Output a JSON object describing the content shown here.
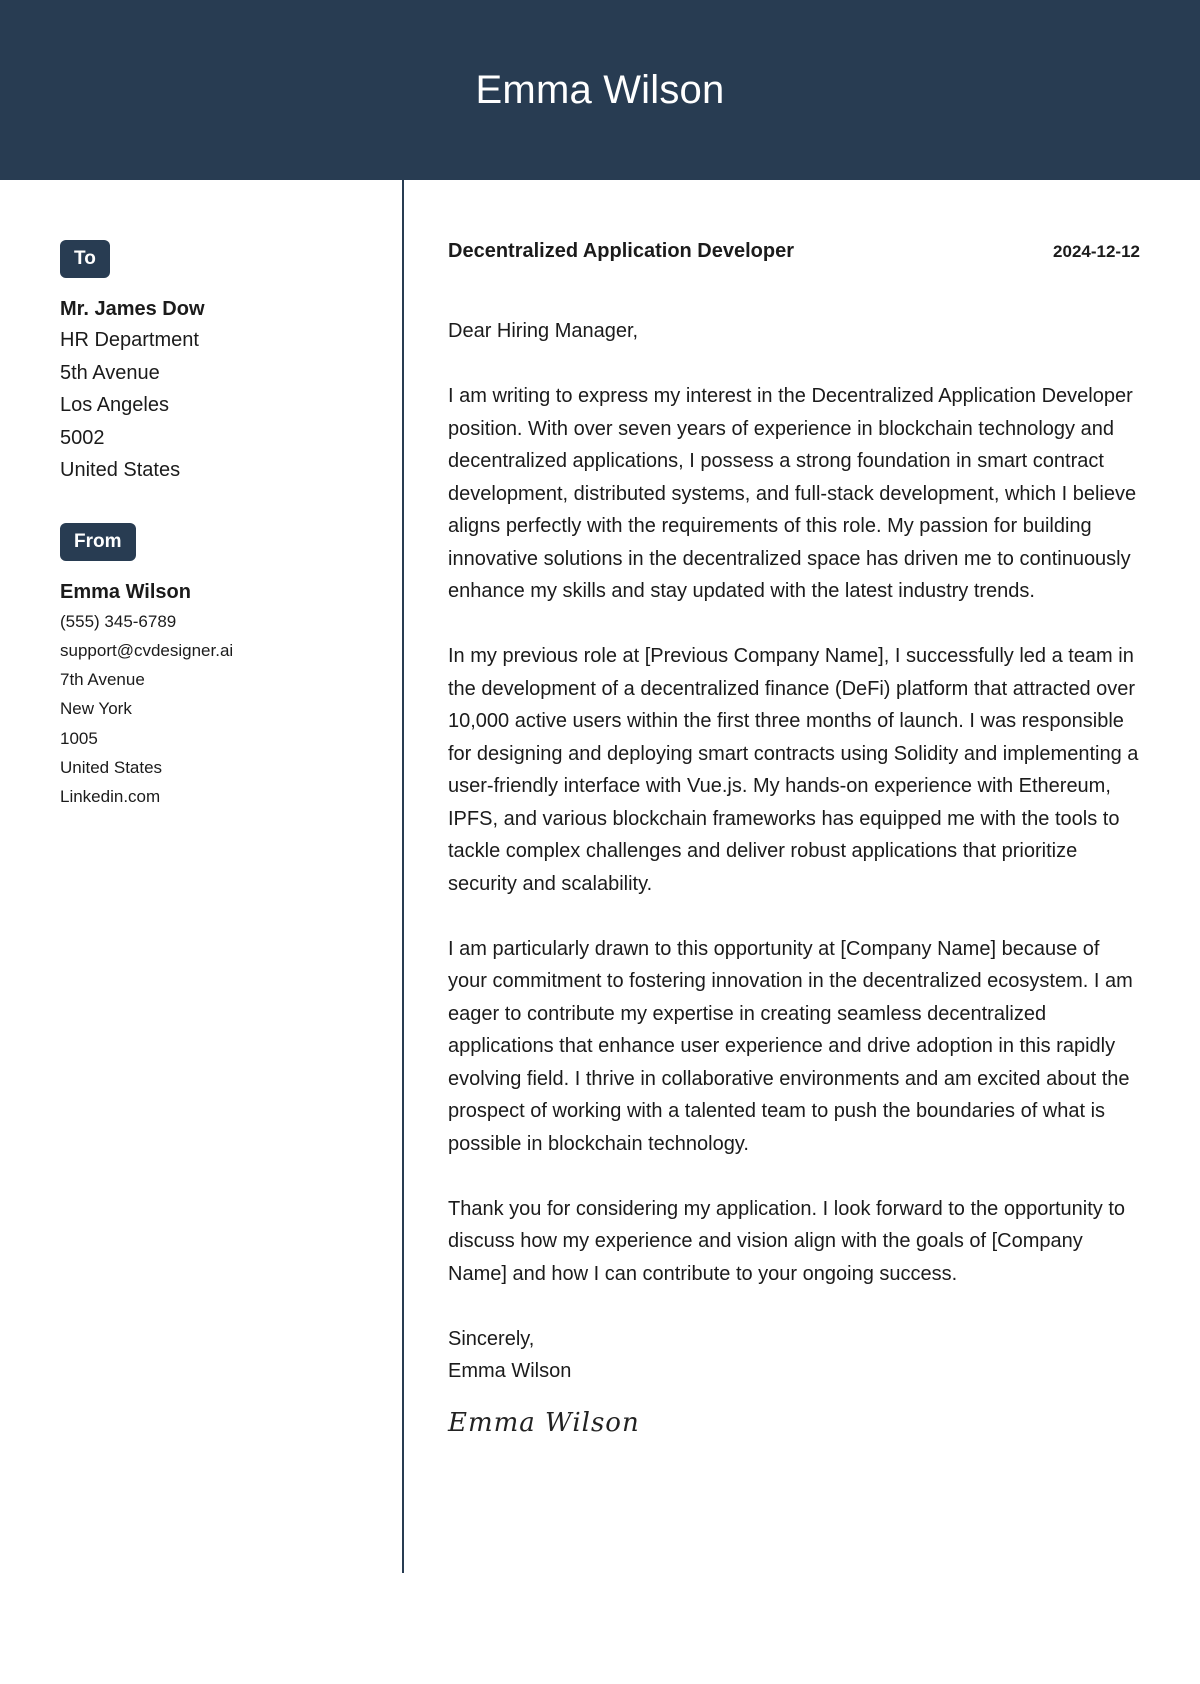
{
  "header": {
    "name": "Emma Wilson"
  },
  "recipient": {
    "badge": "To",
    "name": "Mr. James Dow",
    "lines": [
      "HR Department",
      "5th Avenue",
      "Los Angeles",
      "5002",
      "United States"
    ]
  },
  "sender": {
    "badge": "From",
    "name": "Emma Wilson",
    "lines": [
      "(555) 345-6789",
      "support@cvdesigner.ai",
      "7th Avenue",
      "New York",
      "1005",
      "United States",
      "Linkedin.com"
    ]
  },
  "letter": {
    "job_title": "Decentralized Application Developer",
    "date": "2024-12-12",
    "greeting": "Dear Hiring Manager,",
    "paragraphs": [
      "I am writing to express my interest in the Decentralized Application Developer position. With over seven years of experience in blockchain technology and decentralized applications, I possess a strong foundation in smart contract development, distributed systems, and full-stack development, which I believe aligns perfectly with the requirements of this role. My passion for building innovative solutions in the decentralized space has driven me to continuously enhance my skills and stay updated with the latest industry trends.",
      "In my previous role at [Previous Company Name], I successfully led a team in the development of a decentralized finance (DeFi) platform that attracted over 10,000 active users within the first three months of launch. I was responsible for designing and deploying smart contracts using Solidity and implementing a user-friendly interface with Vue.js. My hands-on experience with Ethereum, IPFS, and various blockchain frameworks has equipped me with the tools to tackle complex challenges and deliver robust applications that prioritize security and scalability.",
      "I am particularly drawn to this opportunity at [Company Name] because of your commitment to fostering innovation in the decentralized ecosystem. I am eager to contribute my expertise in creating seamless decentralized applications that enhance user experience and drive adoption in this rapidly evolving field. I thrive in collaborative environments and am excited about the prospect of working with a talented team to push the boundaries of what is possible in blockchain technology.",
      "Thank you for considering my application. I look forward to the opportunity to discuss how my experience and vision align with the goals of [Company Name] and how I can contribute to your ongoing success."
    ],
    "closing": "Sincerely,",
    "closing_name": "Emma Wilson",
    "signature": "Emma Wilson"
  },
  "colors": {
    "accent": "#283c52",
    "text": "#1b1b1b",
    "background": "#ffffff"
  }
}
